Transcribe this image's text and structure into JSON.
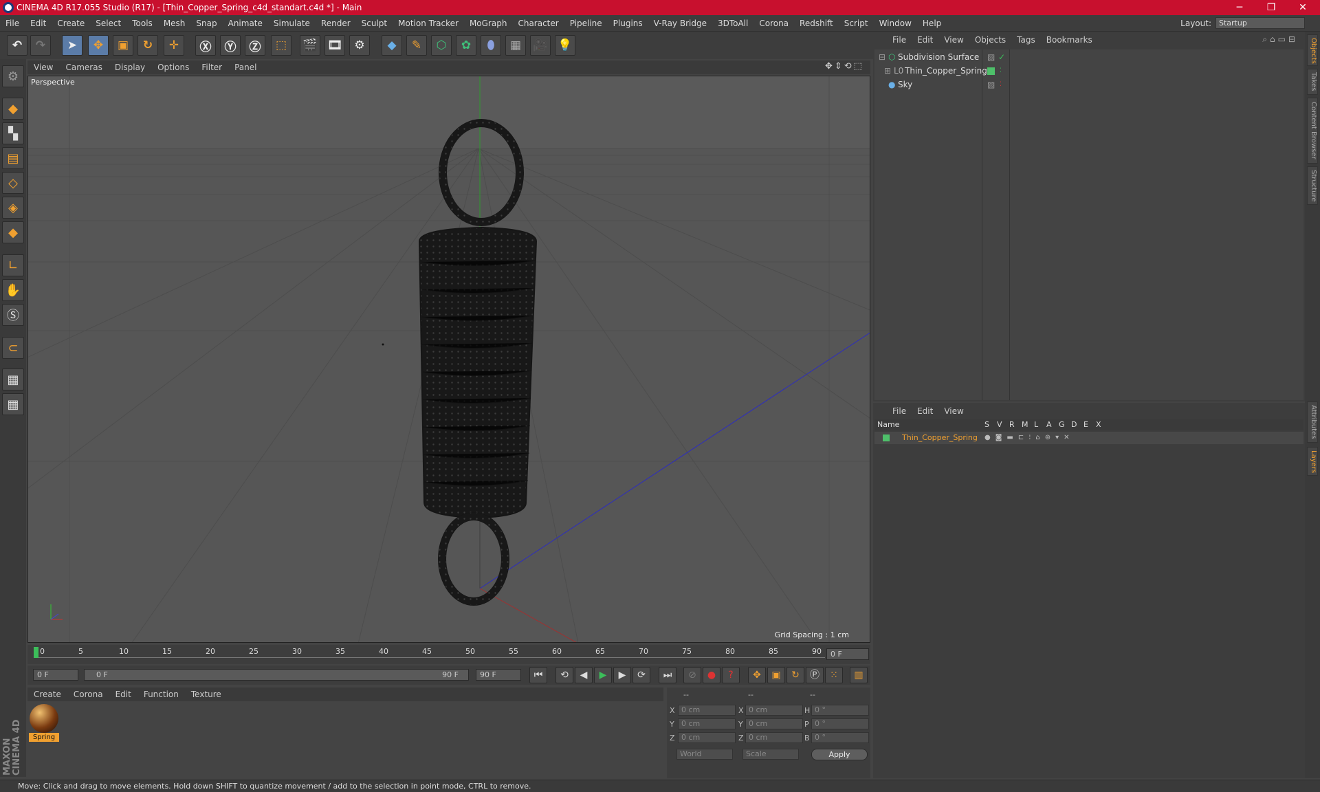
{
  "window": {
    "title": "CINEMA 4D R17.055 Studio (R17) - [Thin_Copper_Spring_c4d_standart.c4d *] - Main",
    "minimize": "─",
    "maximize": "❐",
    "close": "✕"
  },
  "menu": [
    "File",
    "Edit",
    "Create",
    "Select",
    "Tools",
    "Mesh",
    "Snap",
    "Animate",
    "Simulate",
    "Render",
    "Sculpt",
    "Motion Tracker",
    "MoGraph",
    "Character",
    "Pipeline",
    "Plugins",
    "V-Ray Bridge",
    "3DToAll",
    "Corona",
    "Redshift",
    "Script",
    "Window",
    "Help"
  ],
  "layout": {
    "label": "Layout:",
    "value": "Startup"
  },
  "viewport": {
    "menu": [
      "View",
      "Cameras",
      "Display",
      "Options",
      "Filter",
      "Panel"
    ],
    "label": "Perspective",
    "grid_spacing": "Grid Spacing : 1 cm"
  },
  "timeline": {
    "ticks": [
      "0",
      "5",
      "10",
      "15",
      "20",
      "25",
      "30",
      "35",
      "40",
      "45",
      "50",
      "55",
      "60",
      "65",
      "70",
      "75",
      "80",
      "85",
      "90"
    ],
    "current_frame": "0 F",
    "start_field": "0 F",
    "range_start": "0 F",
    "range_end": "90 F",
    "end_field": "90 F"
  },
  "material_panel": {
    "menu": [
      "Create",
      "Corona",
      "Edit",
      "Function",
      "Texture"
    ],
    "material_name": "Spring"
  },
  "coords": {
    "col_heads": [
      "--",
      "--",
      "--"
    ],
    "rows": [
      {
        "a": "X",
        "av": "0 cm",
        "b": "X",
        "bv": "0 cm",
        "c": "H",
        "cv": "0 °"
      },
      {
        "a": "Y",
        "av": "0 cm",
        "b": "Y",
        "bv": "0 cm",
        "c": "P",
        "cv": "0 °"
      },
      {
        "a": "Z",
        "av": "0 cm",
        "b": "Z",
        "bv": "0 cm",
        "c": "B",
        "cv": "0 °"
      }
    ],
    "world": "World",
    "scale": "Scale",
    "apply": "Apply"
  },
  "object_manager": {
    "menu": [
      "File",
      "Edit",
      "View",
      "Objects",
      "Tags",
      "Bookmarks"
    ],
    "objects": [
      {
        "name": "Subdivision Surface"
      },
      {
        "name": "Thin_Copper_Spring"
      },
      {
        "name": "Sky"
      }
    ]
  },
  "layer_manager": {
    "menu": [
      "File",
      "Edit",
      "View"
    ],
    "header": {
      "name": "Name",
      "cols": [
        "S",
        "V",
        "R",
        "M",
        "L",
        "A",
        "G",
        "D",
        "E",
        "X"
      ]
    },
    "layers": [
      {
        "name": "Thin_Copper_Spring",
        "color": "#4ec06a"
      }
    ]
  },
  "right_tabs": [
    "Objects",
    "Takes",
    "Content Browser",
    "Structure",
    "Attributes",
    "Layers"
  ],
  "status": "Move: Click and drag to move elements. Hold down SHIFT to quantize movement / add to the selection in point mode, CTRL to remove.",
  "brand": {
    "maxon": "MAXON",
    "product": "CINEMA 4D"
  },
  "colors": {
    "titlebar": "#c8102e",
    "accent": "#f0a030",
    "selected_tool": "#5b7ca8"
  }
}
